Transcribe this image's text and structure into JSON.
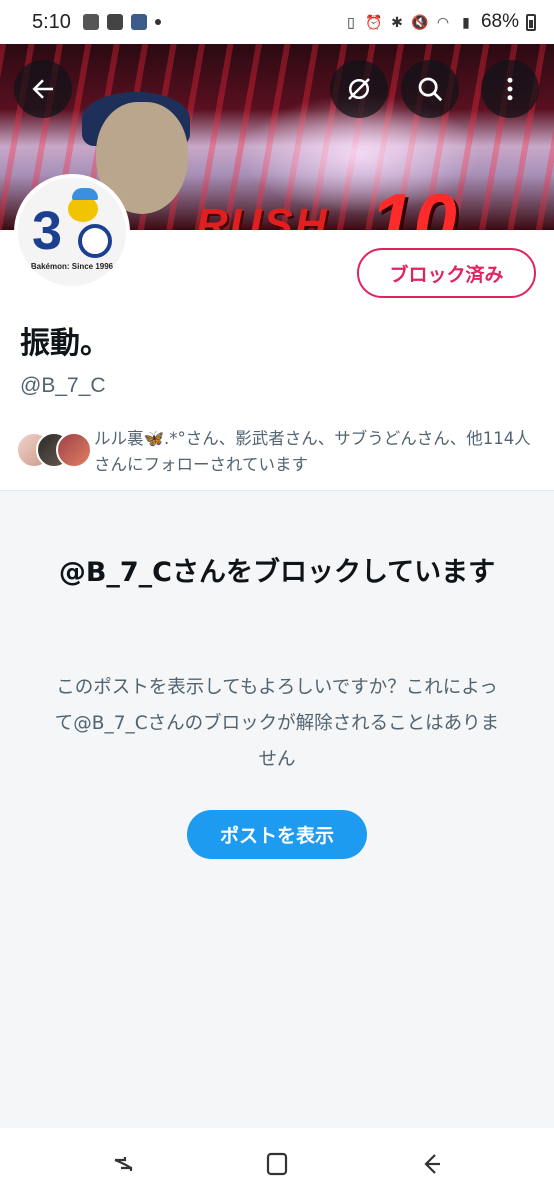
{
  "status_bar": {
    "time": "5:10",
    "battery": "68%",
    "notification_icons": [
      "photo-icon",
      "settings-app-icon",
      "game-icon"
    ],
    "system_icons": [
      "battery-saver-icon",
      "alarm-icon",
      "bluetooth-icon",
      "mute-icon",
      "wifi-icon",
      "signal-icon",
      "battery-icon"
    ]
  },
  "header": {
    "back_icon": "arrow-left-icon",
    "grok_icon": "grok-icon",
    "search_icon": "search-icon",
    "more_icon": "more-vertical-icon",
    "banner_text": "RUSH",
    "banner_number": "10"
  },
  "profile": {
    "avatar_number": "3",
    "avatar_caption": "Bakémon: Since 1996",
    "blocked_button_label": "ブロック済み",
    "display_name": "振動。",
    "handle": "@B_7_C",
    "followers_text": "ルル裏🦋.*°さん、影武者さん、サブうどんさん、他114人さんにフォローされています"
  },
  "blocked_notice": {
    "title": "@B_7_Cさんをブロックしています",
    "description": "このポストを表示してもよろしいですか？これによって@B_7_Cさんのブロックが解除されることはありません",
    "show_post_label": "ポストを表示"
  },
  "nav_bar": {
    "recents_icon": "recents-icon",
    "home_icon": "home-icon",
    "back_icon": "back-icon"
  },
  "colors": {
    "accent_blue": "#1d9bf0",
    "blocked_red": "#e0245e",
    "secondary_text": "#536471",
    "panel_bg": "#f4f6f7"
  }
}
